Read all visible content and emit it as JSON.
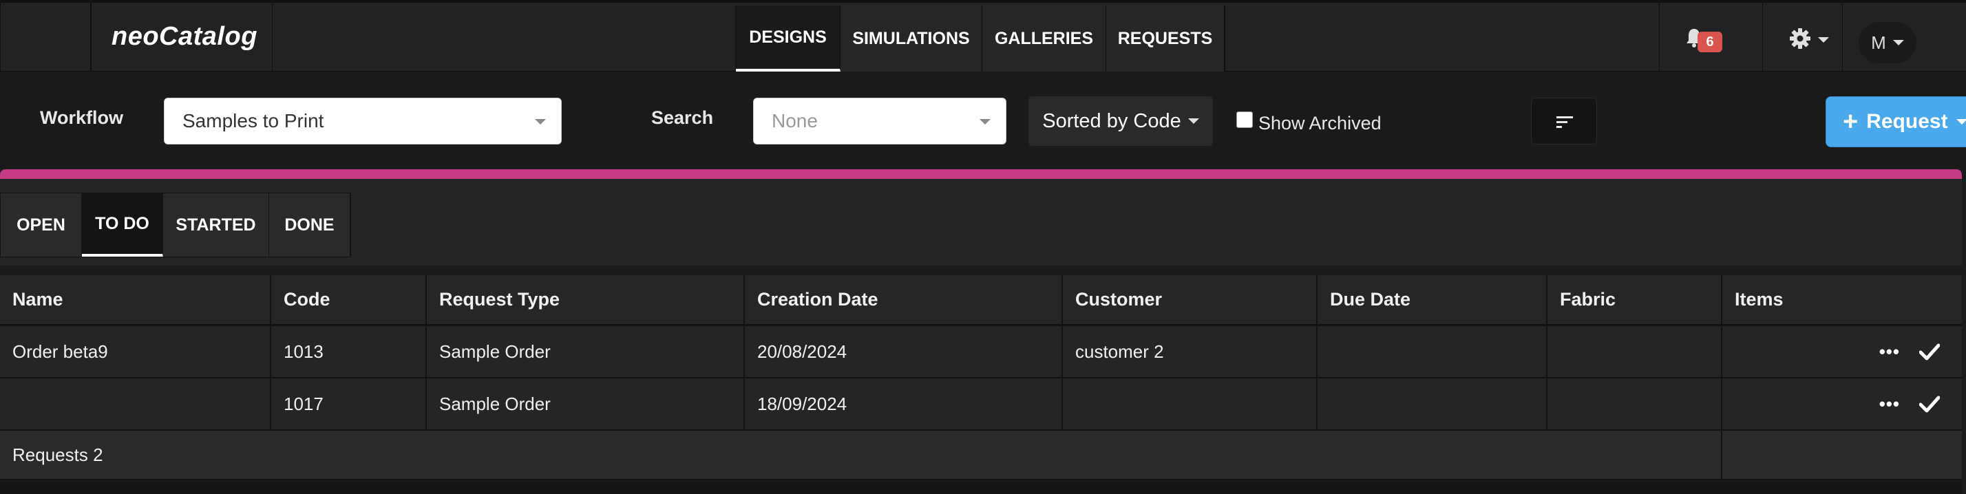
{
  "app": {
    "logo": "neoCatalog"
  },
  "nav": {
    "tabs": [
      {
        "label": "DESIGNS",
        "active": true
      },
      {
        "label": "SIMULATIONS",
        "active": false
      },
      {
        "label": "GALLERIES",
        "active": false
      },
      {
        "label": "REQUESTS",
        "active": false
      }
    ],
    "notifications_count": "6",
    "user_initial": "M"
  },
  "filters": {
    "workflow_label": "Workflow",
    "workflow_value": "Samples to Print",
    "search_label": "Search",
    "search_value": "None",
    "sort_label": "Sorted by Code",
    "show_archived_label": "Show Archived",
    "show_archived_checked": false,
    "request_button": "Request"
  },
  "status_tabs": [
    {
      "label": "OPEN",
      "active": false
    },
    {
      "label": "TO DO",
      "active": true
    },
    {
      "label": "STARTED",
      "active": false
    },
    {
      "label": "DONE",
      "active": false
    }
  ],
  "table": {
    "columns": [
      "Name",
      "Code",
      "Request Type",
      "Creation Date",
      "Customer",
      "Due Date",
      "Fabric",
      "Items"
    ],
    "rows": [
      [
        "Order beta9",
        "1013",
        "Sample Order",
        "20/08/2024",
        "customer 2",
        "",
        ""
      ],
      [
        "",
        "1017",
        "Sample Order",
        "18/09/2024",
        "",
        "",
        ""
      ]
    ],
    "footer": "Requests 2"
  },
  "colors": {
    "accent_stripe": "#c63a86",
    "request_button": "#4aa8ec",
    "badge": "#d9534f"
  }
}
